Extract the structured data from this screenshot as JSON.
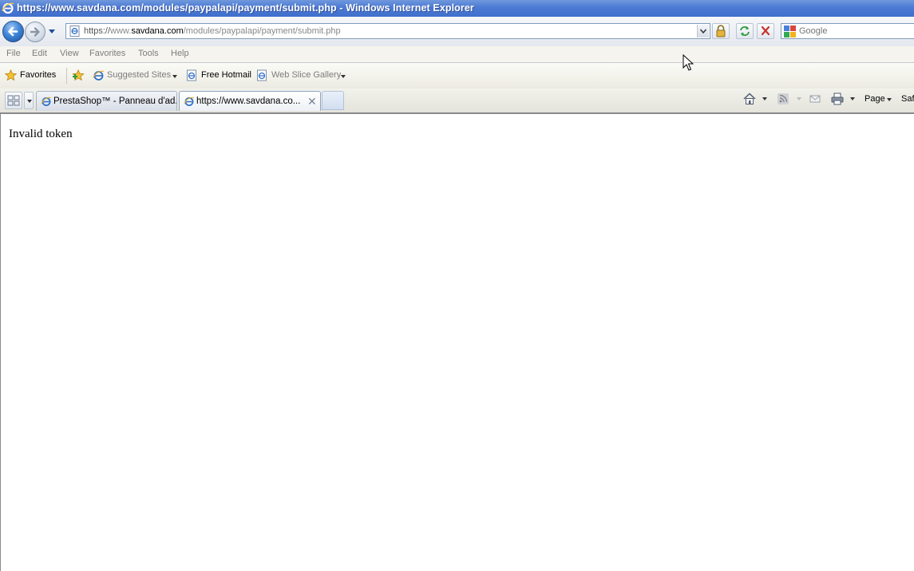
{
  "window": {
    "title": "https://www.savdana.com/modules/paypalapi/payment/submit.php - Windows Internet Explorer"
  },
  "nav": {
    "back_icon": "back-arrow-icon",
    "forward_icon": "forward-arrow-icon"
  },
  "address": {
    "prefix": "https://",
    "www": "www.",
    "host": "savdana.com",
    "path": "/modules/paypalapi/payment/submit.php"
  },
  "search": {
    "placeholder": "Google"
  },
  "menu": {
    "items": [
      "File",
      "Edit",
      "View",
      "Favorites",
      "Tools",
      "Help"
    ]
  },
  "favorites_bar": {
    "favorites_label": "Favorites",
    "items": [
      {
        "label": "Suggested Sites"
      },
      {
        "label": "Free Hotmail"
      },
      {
        "label": "Web Slice Gallery"
      }
    ]
  },
  "tabs": [
    {
      "label": "PrestaShop™ - Panneau d'ad...",
      "active": false
    },
    {
      "label": "https://www.savdana.co...",
      "active": true
    }
  ],
  "command_bar": {
    "page_label": "Page",
    "safety_label": "Saf"
  },
  "page": {
    "message": "Invalid token"
  },
  "colors": {
    "titlebar": "#4c7ad4",
    "accent": "#3f86d8"
  }
}
